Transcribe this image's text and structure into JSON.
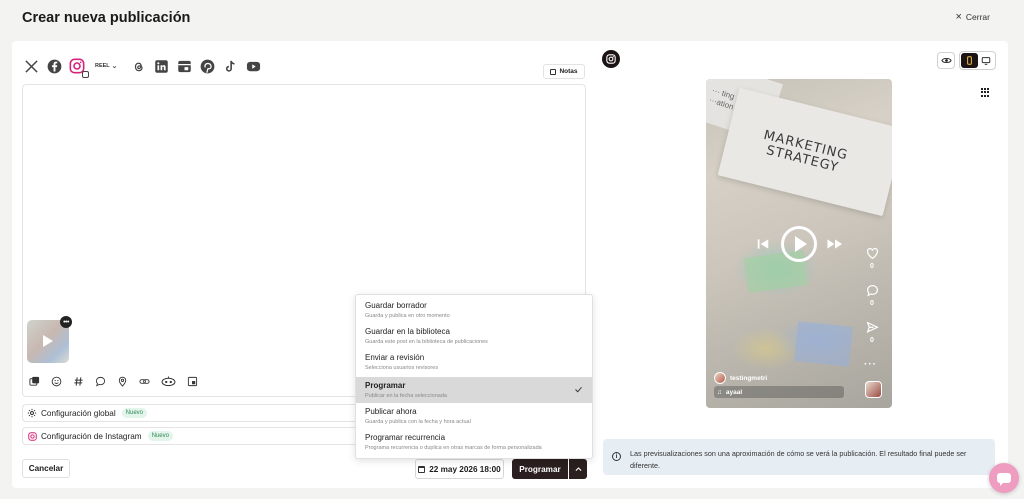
{
  "header": {
    "title": "Crear nueva publicación",
    "close_label": "Cerrar"
  },
  "networks": [
    "x-icon",
    "facebook-icon",
    "instagram-icon",
    "threads-icon",
    "linkedin-icon",
    "google-business-icon",
    "pinterest-icon",
    "tiktok-icon",
    "youtube-icon"
  ],
  "format": {
    "selected": "REEL"
  },
  "notes": {
    "label": "Notas"
  },
  "toolbar": [
    "add-media-icon",
    "emoji-icon",
    "hashtag-icon",
    "comment-icon",
    "location-icon",
    "link-icon",
    "ai-icon",
    "cover-icon"
  ],
  "config": {
    "global_label": "Configuración global",
    "global_badge": "Nuevo",
    "instagram_label": "Configuración de Instagram",
    "instagram_badge": "Nuevo"
  },
  "footer": {
    "cancel_label": "Cancelar",
    "date_label": "22 may 2026 18:00",
    "schedule_label": "Programar"
  },
  "menu": {
    "items": [
      {
        "title": "Guardar borrador",
        "desc": "Guarda y publica en otro momento",
        "selected": false
      },
      {
        "title": "Guardar en la biblioteca",
        "desc": "Guarda este post en la biblioteca de publicaciones",
        "selected": false
      },
      {
        "title": "Enviar a revisión",
        "desc": "Selecciona usuarios revisores",
        "selected": false
      },
      {
        "title": "Programar",
        "desc": "Publicar en la fecha seleccionada",
        "selected": true
      },
      {
        "title": "Publicar ahora",
        "desc": "Guarda y publica con la fecha y hora actual",
        "selected": false
      },
      {
        "title": "Programar recurrencia",
        "desc": "Programa recurrencia o duplica en otras marcas de forma personalizada",
        "selected": false
      }
    ]
  },
  "preview": {
    "image_text": "MARKETING STRATEGY",
    "likes": "0",
    "comments": "0",
    "shares": "0",
    "username": "testingmetri",
    "audio": "ayaal",
    "info_text": "Las previsualizaciones son una aproximación de cómo se verá la publicación. El resultado final puede ser diferente."
  },
  "colors": {
    "primary_button": "#2b1f1f",
    "badge_green": "#2f8a57",
    "chat_fab": "#ef9cc1",
    "info_bg": "#e6edf3"
  }
}
